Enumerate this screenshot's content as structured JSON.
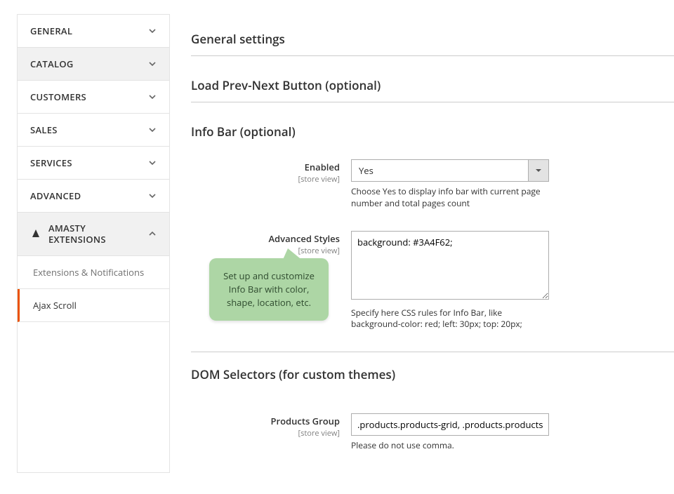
{
  "sidebar": {
    "items": [
      {
        "label": "General"
      },
      {
        "label": "Catalog"
      },
      {
        "label": "Customers"
      },
      {
        "label": "Sales"
      },
      {
        "label": "Services"
      },
      {
        "label": "Advanced"
      }
    ],
    "amasty_brand1": "Amasty",
    "amasty_brand2": "Extensions",
    "sub1": "Extensions & Notifications",
    "sub2": "Ajax Scroll"
  },
  "sections": {
    "general": "General settings",
    "loadbtn": "Load Prev-Next Button (optional)",
    "infobar": "Info Bar (optional)",
    "dom": "DOM Selectors (for custom themes)"
  },
  "scope_label": "[store view]",
  "infobar": {
    "enabled_label": "Enabled",
    "enabled_value": "Yes",
    "enabled_note": "Choose Yes to display info bar with current page number and total pages count",
    "styles_label": "Advanced Styles",
    "styles_value": "background: #3A4F62;",
    "styles_note": "Specify here CSS rules for Info Bar, like background-color: red; left: 30px; top: 20px;"
  },
  "dom": {
    "pgroup_label": "Products Group",
    "pgroup_value": ".products.products-grid, .products.products-list",
    "pgroup_note": "Please do not use comma."
  },
  "callout": "Set up and customize Info Bar with color, shape, location, etc."
}
